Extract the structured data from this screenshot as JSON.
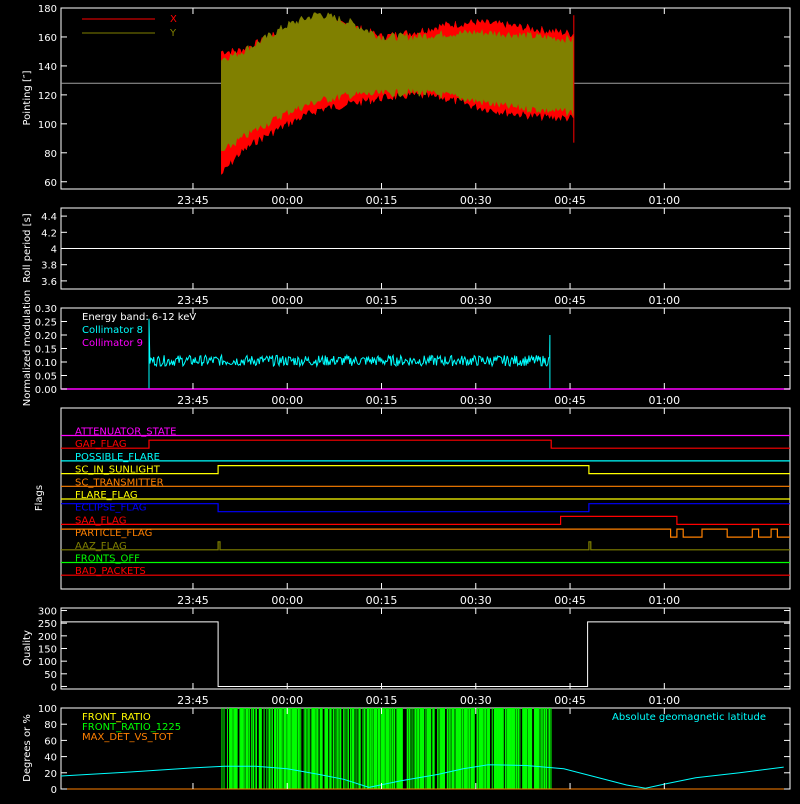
{
  "colors": {
    "background": "#000000",
    "axes": "#ffffff",
    "x_pointing": "#ff0000",
    "y_pointing": "#808000",
    "collimator8": "#00ffff",
    "collimator9": "#ff00ff",
    "front_ratio_bars": "#00ff00",
    "geomag": "#00ffff"
  },
  "chart_data": [
    {
      "type": "area",
      "ylabel": "Pointing [″]",
      "ylim": [
        55,
        180
      ],
      "yticks": [
        60,
        80,
        100,
        120,
        140,
        160,
        180
      ],
      "xticks": [
        "23:45",
        "00:00",
        "00:15",
        "00:30",
        "00:45",
        "01:00"
      ],
      "legend": "top-left",
      "series": [
        {
          "name": "X",
          "color": "#ff0000",
          "x": [
            -10.5,
            -8,
            -5,
            0,
            5,
            10,
            15,
            20,
            25,
            30,
            35,
            40,
            45.5
          ],
          "low": [
            65,
            78,
            88,
            100,
            110,
            114,
            118,
            120,
            118,
            112,
            108,
            105,
            104
          ],
          "high": [
            150,
            150,
            155,
            165,
            170,
            168,
            160,
            163,
            168,
            170,
            168,
            165,
            162
          ]
        },
        {
          "name": "Y",
          "color": "#808000",
          "x": [
            -10.5,
            -8,
            -5,
            0,
            5,
            10,
            15,
            20,
            25,
            30,
            35,
            40,
            45.5
          ],
          "low": [
            80,
            88,
            96,
            108,
            116,
            120,
            121,
            122,
            120,
            116,
            112,
            110,
            108
          ],
          "high": [
            145,
            148,
            155,
            168,
            176,
            170,
            160,
            160,
            162,
            163,
            162,
            160,
            158
          ]
        }
      ],
      "reference_line": 128
    },
    {
      "type": "line",
      "ylabel": "Roll period [s]",
      "ylim": [
        3.5,
        4.5
      ],
      "yticks": [
        3.6,
        3.8,
        4.0,
        4.2,
        4.4
      ],
      "xticks": [
        "23:45",
        "00:00",
        "00:15",
        "00:30",
        "00:45",
        "01:00"
      ],
      "value": 4.0
    },
    {
      "type": "line",
      "ylabel": "Normalized modulation",
      "ylim": [
        0,
        0.3
      ],
      "yticks": [
        "0.00",
        "0.05",
        "0.10",
        "0.15",
        "0.20",
        "0.25",
        "0.30"
      ],
      "xticks": [
        "23:45",
        "00:00",
        "00:15",
        "00:30",
        "00:45",
        "01:00"
      ],
      "annotation": "Energy band: 6-12 keV",
      "legend": "top-left",
      "series": [
        {
          "name": "Collimator 8",
          "color": "#00ffff",
          "x_range": [
            -22,
            41.8
          ],
          "mean": 0.105,
          "spread": 0.02,
          "spike_start": 0.26,
          "spike_end": 0.2
        },
        {
          "name": "Collimator 9",
          "color": "#ff00ff",
          "value": 0.0
        }
      ]
    },
    {
      "type": "line",
      "ylabel": "Flags",
      "xticks": [
        "23:45",
        "00:00",
        "00:15",
        "00:30",
        "00:45",
        "01:00"
      ],
      "series": [
        {
          "name": "ATTENUATOR_STATE",
          "color": "#ff00ff",
          "steps": [
            [
              -36,
              0
            ]
          ]
        },
        {
          "name": "GAP_FLAG",
          "color": "#ff0000",
          "steps": [
            [
              -36,
              0
            ],
            [
              -22,
              1
            ],
            [
              42,
              0
            ]
          ]
        },
        {
          "name": "POSSIBLE_FLARE",
          "color": "#00ffff",
          "steps": [
            [
              -36,
              0
            ]
          ]
        },
        {
          "name": "SC_IN_SUNLIGHT",
          "color": "#ffff00",
          "steps": [
            [
              -36,
              0
            ],
            [
              -11,
              1
            ],
            [
              48,
              0
            ]
          ]
        },
        {
          "name": "SC_TRANSMITTER",
          "color": "#ff8000",
          "steps": [
            [
              -36,
              0
            ]
          ]
        },
        {
          "name": "FLARE_FLAG",
          "color": "#ffff00",
          "steps": [
            [
              -36,
              0
            ]
          ]
        },
        {
          "name": "ECLIPSE_FLAG",
          "color": "#0000ff",
          "steps": [
            [
              -36,
              1
            ],
            [
              -11,
              0
            ],
            [
              48,
              1
            ]
          ]
        },
        {
          "name": "SAA_FLAG",
          "color": "#ff0000",
          "steps": [
            [
              -36,
              0
            ],
            [
              43.5,
              1
            ],
            [
              62,
              0
            ]
          ]
        },
        {
          "name": "PARTICLE_FLAG",
          "color": "#ff8000",
          "steps": [
            [
              -36,
              1
            ],
            [
              61,
              0
            ],
            [
              62,
              1
            ],
            [
              63,
              0
            ],
            [
              66,
              1
            ],
            [
              70,
              0
            ],
            [
              74,
              1
            ],
            [
              75,
              0
            ],
            [
              77,
              1
            ],
            [
              78,
              0
            ]
          ]
        },
        {
          "name": "AAZ_FLAG",
          "color": "#808000",
          "steps": [
            [
              -36,
              0
            ],
            [
              -11,
              1
            ],
            [
              -10.7,
              0
            ],
            [
              48,
              1
            ],
            [
              48.3,
              0
            ]
          ]
        },
        {
          "name": "FRONTS_OFF",
          "color": "#00ff00",
          "steps": [
            [
              -36,
              0
            ]
          ]
        },
        {
          "name": "BAD_PACKETS",
          "color": "#ff0000",
          "steps": [
            [
              -36,
              0
            ]
          ]
        }
      ]
    },
    {
      "type": "line",
      "ylabel": "Quality",
      "ylim": [
        -10,
        310
      ],
      "yticks": [
        0,
        50,
        100,
        150,
        200,
        250,
        300
      ],
      "xticks": [
        "23:45",
        "00:00",
        "00:15",
        "00:30",
        "00:45",
        "01:00"
      ],
      "series": [
        {
          "name": "Quality",
          "color": "#ffffff",
          "steps": [
            [
              -36,
              255
            ],
            [
              -11,
              0
            ],
            [
              47.8,
              255
            ]
          ]
        }
      ]
    },
    {
      "type": "bar",
      "ylabel": "Degrees or %",
      "ylim": [
        0,
        100
      ],
      "yticks": [
        0,
        20,
        40,
        60,
        80,
        100
      ],
      "legend": "top-left",
      "series": [
        {
          "name": "FRONT_RATIO",
          "color": "#ffff00"
        },
        {
          "name": "FRONT_RATIO_1225",
          "color": "#00ff00",
          "x_range": [
            -10.5,
            42
          ],
          "value": 100
        },
        {
          "name": "MAX_DET_VS_TOT",
          "color": "#ff8000"
        },
        {
          "name": "Absolute geomagnetic latitude",
          "color": "#00ffff",
          "x": [
            -36,
            -25,
            -15,
            -10,
            -5,
            0,
            5,
            9,
            13,
            18,
            24,
            28,
            32,
            38,
            44,
            50,
            54,
            57,
            60,
            65,
            72,
            79
          ],
          "y": [
            16,
            21,
            26,
            28,
            28,
            25,
            18,
            12,
            2,
            10,
            18,
            25,
            30,
            29,
            25,
            13,
            5,
            1,
            6,
            14,
            20,
            27
          ]
        }
      ]
    }
  ]
}
